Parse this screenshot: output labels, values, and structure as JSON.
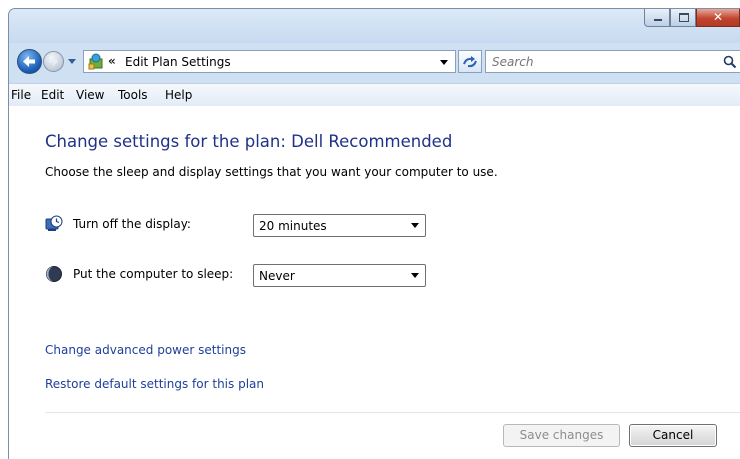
{
  "window": {
    "controls": {
      "minimize_icon": "minimize-icon",
      "maximize_icon": "maximize-icon",
      "close_glyph": "✕"
    }
  },
  "nav": {
    "breadcrumb_chevron": "«",
    "breadcrumb": "Edit Plan Settings",
    "search_placeholder": "Search"
  },
  "menu": [
    "File",
    "Edit",
    "View",
    "Tools",
    "Help"
  ],
  "main": {
    "heading": "Change settings for the plan: Dell Recommended",
    "subtext": "Choose the sleep and display settings that you want your computer to use.",
    "display_label": "Turn off the display:",
    "display_value": "20 minutes",
    "sleep_label": "Put the computer to sleep:",
    "sleep_value": "Never",
    "link_advanced": "Change advanced power settings",
    "link_restore": "Restore default settings for this plan"
  },
  "buttons": {
    "save": "Save changes",
    "cancel": "Cancel"
  },
  "colors": {
    "heading": "#1e3287",
    "link": "#1f3f9a",
    "window_frame": "#cfe0f2",
    "close_button": "#c1452f"
  }
}
